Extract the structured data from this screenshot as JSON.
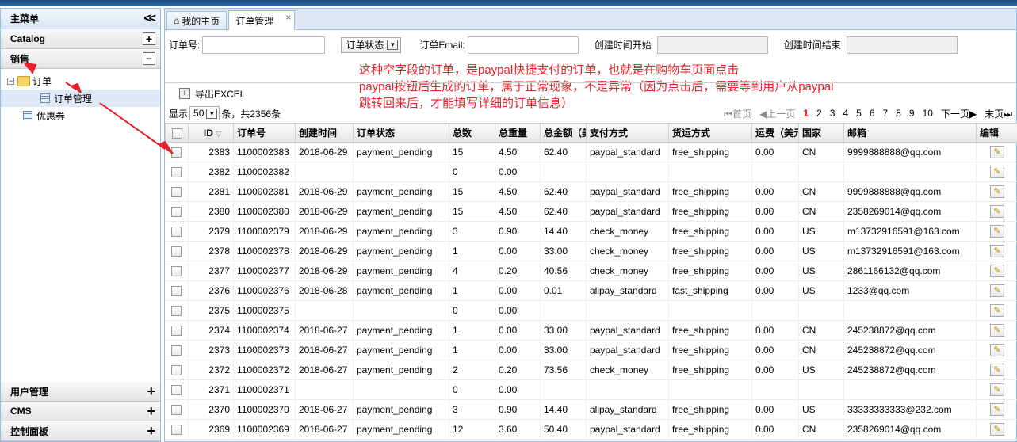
{
  "sidebar": {
    "title": "主菜单",
    "collapse_icon": "double-chevron-left-icon",
    "sections": {
      "catalog": "Catalog",
      "sales": "销售"
    },
    "tree": {
      "orders": "订单",
      "order_management": "订单管理",
      "coupons": "优惠券"
    },
    "bottom_sections": [
      "用户管理",
      "CMS",
      "控制面板"
    ]
  },
  "tabs": [
    {
      "label": "我的主页",
      "icon": "home-icon"
    },
    {
      "label": "订单管理",
      "close": "×"
    }
  ],
  "filters": {
    "order_no_label": "订单号:",
    "order_status_label": "订单状态",
    "email_label": "订单Email:",
    "created_start_label": "创建时间开始",
    "created_end_label": "创建时间结束"
  },
  "annotation": {
    "line1": "这种空字段的订单，是paypal快捷支付的订单，也就是在购物车页面点击",
    "line2": "paypal按钮后生成的订单，属于正常现象，不是异常（因为点击后，需要等到用户从paypal",
    "line3": "跳转回来后，才能填写详细的订单信息）",
    "color": "#e8202a"
  },
  "toolbar": {
    "export_label": "导出EXCEL"
  },
  "pager": {
    "show_label": "显示",
    "page_size": "50",
    "summary": "条，共2356条",
    "first": "首页",
    "prev": "上一页",
    "pages": [
      "1",
      "2",
      "3",
      "4",
      "5",
      "6",
      "7",
      "8",
      "9",
      "10"
    ],
    "current_page": "1",
    "next": "下一页",
    "last": "末页"
  },
  "grid": {
    "columns": [
      "ID",
      "订单号",
      "创建时间",
      "订单状态",
      "总数",
      "总重量",
      "总金额（美",
      "支付方式",
      "货运方式",
      "运费（美元",
      "国家",
      "邮箱",
      "编辑"
    ],
    "rows": [
      [
        "2383",
        "1100002383",
        "2018-06-29",
        "payment_pending",
        "15",
        "4.50",
        "62.40",
        "paypal_standard",
        "free_shipping",
        "0.00",
        "CN",
        "9999888888@qq.com"
      ],
      [
        "2382",
        "1100002382",
        "",
        "",
        "0",
        "0.00",
        "",
        "",
        "",
        "",
        "",
        ""
      ],
      [
        "2381",
        "1100002381",
        "2018-06-29",
        "payment_pending",
        "15",
        "4.50",
        "62.40",
        "paypal_standard",
        "free_shipping",
        "0.00",
        "CN",
        "9999888888@qq.com"
      ],
      [
        "2380",
        "1100002380",
        "2018-06-29",
        "payment_pending",
        "15",
        "4.50",
        "62.40",
        "paypal_standard",
        "free_shipping",
        "0.00",
        "CN",
        "2358269014@qq.com"
      ],
      [
        "2379",
        "1100002379",
        "2018-06-29",
        "payment_pending",
        "3",
        "0.90",
        "14.40",
        "check_money",
        "free_shipping",
        "0.00",
        "US",
        "m13732916591@163.com"
      ],
      [
        "2378",
        "1100002378",
        "2018-06-29",
        "payment_pending",
        "1",
        "0.00",
        "33.00",
        "check_money",
        "free_shipping",
        "0.00",
        "US",
        "m13732916591@163.com"
      ],
      [
        "2377",
        "1100002377",
        "2018-06-29",
        "payment_pending",
        "4",
        "0.20",
        "40.56",
        "check_money",
        "free_shipping",
        "0.00",
        "US",
        "2861166132@qq.com"
      ],
      [
        "2376",
        "1100002376",
        "2018-06-28",
        "payment_pending",
        "1",
        "0.00",
        "0.01",
        "alipay_standard",
        "fast_shipping",
        "0.00",
        "US",
        "1233@qq.com"
      ],
      [
        "2375",
        "1100002375",
        "",
        "",
        "0",
        "0.00",
        "",
        "",
        "",
        "",
        "",
        ""
      ],
      [
        "2374",
        "1100002374",
        "2018-06-27",
        "payment_pending",
        "1",
        "0.00",
        "33.00",
        "paypal_standard",
        "free_shipping",
        "0.00",
        "CN",
        "245238872@qq.com"
      ],
      [
        "2373",
        "1100002373",
        "2018-06-27",
        "payment_pending",
        "1",
        "0.00",
        "33.00",
        "paypal_standard",
        "free_shipping",
        "0.00",
        "CN",
        "245238872@qq.com"
      ],
      [
        "2372",
        "1100002372",
        "2018-06-27",
        "payment_pending",
        "2",
        "0.20",
        "73.56",
        "check_money",
        "free_shipping",
        "0.00",
        "US",
        "245238872@qq.com"
      ],
      [
        "2371",
        "1100002371",
        "",
        "",
        "0",
        "0.00",
        "",
        "",
        "",
        "",
        "",
        ""
      ],
      [
        "2370",
        "1100002370",
        "2018-06-27",
        "payment_pending",
        "3",
        "0.90",
        "14.40",
        "alipay_standard",
        "free_shipping",
        "0.00",
        "US",
        "33333333333@232.com"
      ],
      [
        "2369",
        "1100002369",
        "2018-06-27",
        "payment_pending",
        "12",
        "3.60",
        "50.40",
        "paypal_standard",
        "free_shipping",
        "0.00",
        "CN",
        "2358269014@qq.com"
      ]
    ]
  }
}
